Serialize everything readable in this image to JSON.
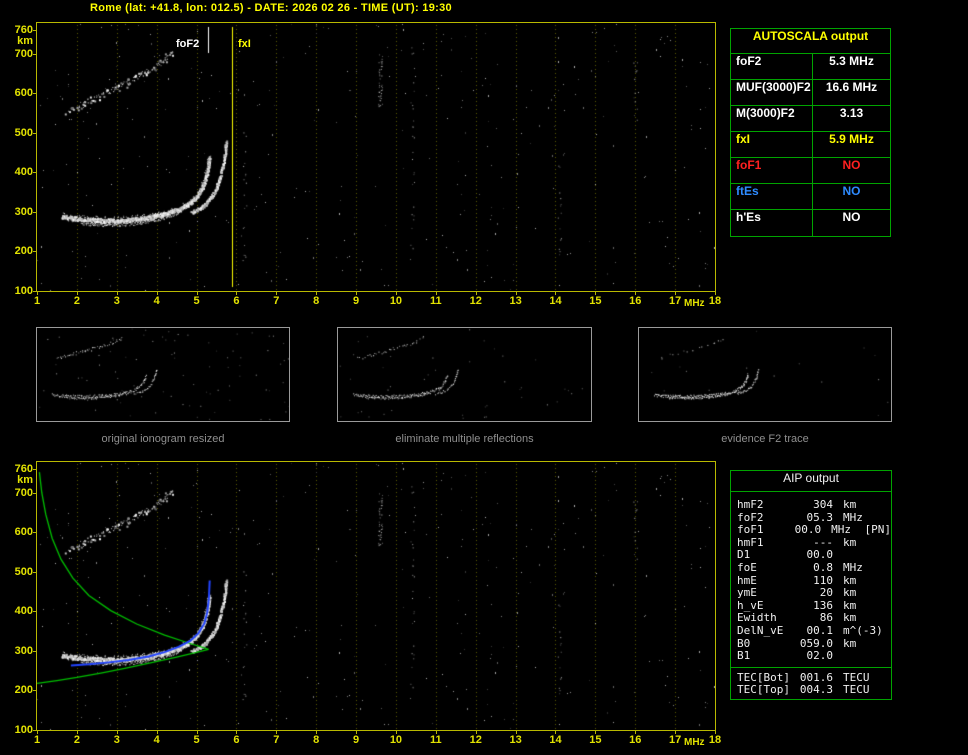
{
  "title": "Rome (lat: +41.8, lon: 012.5) - DATE: 2026 02 26 - TIME (UT): 19:30",
  "colors": {
    "background": "#000000",
    "axis_border": "#b9b900",
    "tick_text": "#e3e300",
    "grid": "#5f5f00",
    "table_border": "#00a400",
    "accent_yellow": "#ffff00",
    "accent_red": "#ff2020",
    "accent_blue": "#2e8bff",
    "trace_white": "#ffffff",
    "profile_green": "#00c000",
    "restored_blue": "#2244ff",
    "caption_gray": "#8f8f8f"
  },
  "autoscala_table": {
    "header": "AUTOSCALA output",
    "rows": [
      {
        "label": "foF2",
        "value": "5.3 MHz",
        "color": "#ffffff"
      },
      {
        "label": "MUF(3000)F2",
        "value": "16.6 MHz",
        "color": "#ffffff"
      },
      {
        "label": "M(3000)F2",
        "value": "3.13",
        "color": "#ffffff"
      },
      {
        "label": "fxI",
        "value": "5.9 MHz",
        "color": "#ffff00"
      },
      {
        "label": "foF1",
        "value": "NO",
        "color": "#ff2020"
      },
      {
        "label": "ftEs",
        "value": "NO",
        "color": "#2e8bff"
      },
      {
        "label": "h'Es",
        "value": "NO",
        "color": "#ffffff"
      }
    ]
  },
  "aip_table": {
    "header": "AIP output",
    "rows": [
      {
        "label": "hmF2",
        "value": "304",
        "unit": "km",
        "extra": ""
      },
      {
        "label": "foF2",
        "value": "05.3",
        "unit": "MHz",
        "extra": ""
      },
      {
        "label": "foF1",
        "value": "00.0",
        "unit": "MHz",
        "extra": "[PN]"
      },
      {
        "label": "hmF1",
        "value": "---",
        "unit": "km",
        "extra": ""
      },
      {
        "label": "D1",
        "value": "00.0",
        "unit": "",
        "extra": ""
      },
      {
        "label": "foE",
        "value": "0.8",
        "unit": "MHz",
        "extra": ""
      },
      {
        "label": "hmE",
        "value": "110",
        "unit": "km",
        "extra": ""
      },
      {
        "label": "ymE",
        "value": "20",
        "unit": "km",
        "extra": ""
      },
      {
        "label": "h_vE",
        "value": "136",
        "unit": "km",
        "extra": ""
      },
      {
        "label": "Ewidth",
        "value": "86",
        "unit": "km",
        "extra": ""
      },
      {
        "label": "DelN_vE",
        "value": "00.1",
        "unit": "m^(-3)",
        "extra": ""
      },
      {
        "label": "B0",
        "value": "059.0",
        "unit": "km",
        "extra": ""
      },
      {
        "label": "B1",
        "value": "02.0",
        "unit": "",
        "extra": ""
      }
    ],
    "tec_rows": [
      {
        "label": "TEC[Bot]",
        "value": "001.6",
        "unit": "TECU",
        "extra": ""
      },
      {
        "label": "TEC[Top]",
        "value": "004.3",
        "unit": "TECU",
        "extra": ""
      }
    ]
  },
  "thumbnails": [
    {
      "caption": "original ionogram resized"
    },
    {
      "caption": "eliminate multiple reflections"
    },
    {
      "caption": "evidence F2 trace"
    }
  ],
  "chart_data": [
    {
      "id": "main-ionogram",
      "type": "scatter",
      "title": "",
      "xlabel": "MHz",
      "ylabel": "km",
      "x_range": [
        1,
        18
      ],
      "y_range": [
        100,
        760
      ],
      "x_ticks": [
        1,
        2,
        3,
        4,
        5,
        6,
        7,
        8,
        9,
        10,
        11,
        12,
        13,
        14,
        15,
        16,
        17,
        18
      ],
      "y_ticks": [
        760,
        700,
        600,
        500,
        400,
        300,
        200,
        100
      ],
      "grid": "vertical-dotted",
      "markers": {
        "foF2_MHz": 5.3,
        "fxI_MHz": 5.9
      },
      "marker_labels": {
        "foF2": "foF2",
        "fxI": "fxI"
      },
      "thumbnail_x_range": [
        1,
        11
      ],
      "noise_seed": 1234,
      "noise_dots": 340,
      "streaks": [
        {
          "f": 9.6,
          "k0": 560,
          "k1": 700,
          "n": 45
        },
        {
          "f": 10.4,
          "k0": 140,
          "k1": 720,
          "n": 25
        },
        {
          "f": 6.2,
          "k0": 150,
          "k1": 520,
          "n": 18
        },
        {
          "f": 14.1,
          "k0": 160,
          "k1": 420,
          "n": 14
        },
        {
          "f": 16.0,
          "k0": 520,
          "k1": 700,
          "n": 12
        }
      ],
      "traces": {
        "f2_ordinary": [
          [
            1.6,
            290
          ],
          [
            1.9,
            285
          ],
          [
            2.3,
            281
          ],
          [
            2.8,
            279
          ],
          [
            3.3,
            281
          ],
          [
            3.8,
            287
          ],
          [
            4.2,
            296
          ],
          [
            4.55,
            308
          ],
          [
            4.8,
            322
          ],
          [
            5.0,
            340
          ],
          [
            5.13,
            362
          ],
          [
            5.22,
            388
          ],
          [
            5.28,
            414
          ],
          [
            5.31,
            438
          ]
        ],
        "f2_lower": [
          [
            2.1,
            271
          ],
          [
            2.6,
            268
          ],
          [
            3.1,
            268
          ],
          [
            3.6,
            272
          ],
          [
            4.0,
            280
          ],
          [
            4.35,
            291
          ],
          [
            4.6,
            303
          ]
        ],
        "f2_extraordinary": [
          [
            4.85,
            300
          ],
          [
            5.1,
            312
          ],
          [
            5.3,
            330
          ],
          [
            5.45,
            352
          ],
          [
            5.55,
            378
          ],
          [
            5.63,
            408
          ],
          [
            5.69,
            444
          ],
          [
            5.73,
            480
          ]
        ],
        "second_hop": [
          [
            1.75,
            555
          ],
          [
            2.1,
            572
          ],
          [
            2.5,
            592
          ],
          [
            2.9,
            610
          ],
          [
            3.3,
            630
          ],
          [
            3.65,
            650
          ],
          [
            3.95,
            668
          ],
          [
            4.2,
            686
          ],
          [
            4.4,
            706
          ]
        ]
      }
    },
    {
      "id": "profile-ionogram",
      "type": "scatter",
      "title": "",
      "xlabel": "MHz",
      "ylabel": "km",
      "x_range": [
        1,
        18
      ],
      "y_range": [
        100,
        760
      ],
      "x_ticks": [
        1,
        2,
        3,
        4,
        5,
        6,
        7,
        8,
        9,
        10,
        11,
        12,
        13,
        14,
        15,
        16,
        17,
        18
      ],
      "y_ticks": [
        760,
        700,
        600,
        500,
        400,
        300,
        200,
        100
      ],
      "grid": "vertical-dotted",
      "noise_seed": 1234,
      "noise_dots": 340,
      "streaks": [
        {
          "f": 9.6,
          "k0": 560,
          "k1": 700,
          "n": 45
        },
        {
          "f": 10.4,
          "k0": 140,
          "k1": 720,
          "n": 25
        },
        {
          "f": 6.2,
          "k0": 150,
          "k1": 520,
          "n": 18
        },
        {
          "f": 14.1,
          "k0": 160,
          "k1": 420,
          "n": 14
        },
        {
          "f": 16.0,
          "k0": 520,
          "k1": 700,
          "n": 12
        }
      ],
      "traces": {
        "f2_ordinary": [
          [
            1.6,
            290
          ],
          [
            1.9,
            285
          ],
          [
            2.3,
            281
          ],
          [
            2.8,
            279
          ],
          [
            3.3,
            281
          ],
          [
            3.8,
            287
          ],
          [
            4.2,
            296
          ],
          [
            4.55,
            308
          ],
          [
            4.8,
            322
          ],
          [
            5.0,
            340
          ],
          [
            5.13,
            362
          ],
          [
            5.22,
            388
          ],
          [
            5.28,
            414
          ],
          [
            5.31,
            438
          ]
        ],
        "f2_lower": [
          [
            2.1,
            271
          ],
          [
            2.6,
            268
          ],
          [
            3.1,
            268
          ],
          [
            3.6,
            272
          ],
          [
            4.0,
            280
          ],
          [
            4.35,
            291
          ],
          [
            4.6,
            303
          ]
        ],
        "f2_extraordinary": [
          [
            4.85,
            300
          ],
          [
            5.1,
            312
          ],
          [
            5.3,
            330
          ],
          [
            5.45,
            352
          ],
          [
            5.55,
            378
          ],
          [
            5.63,
            408
          ],
          [
            5.69,
            444
          ],
          [
            5.73,
            480
          ]
        ],
        "second_hop": [
          [
            1.75,
            555
          ],
          [
            2.1,
            572
          ],
          [
            2.5,
            592
          ],
          [
            2.9,
            610
          ],
          [
            3.3,
            630
          ],
          [
            3.65,
            650
          ],
          [
            3.95,
            668
          ],
          [
            4.2,
            686
          ],
          [
            4.4,
            706
          ]
        ]
      },
      "profile_green": {
        "topside": [
          [
            1.06,
            752
          ],
          [
            1.12,
            700
          ],
          [
            1.22,
            645
          ],
          [
            1.38,
            585
          ],
          [
            1.6,
            532
          ],
          [
            1.9,
            484
          ],
          [
            2.3,
            440
          ],
          [
            2.85,
            402
          ],
          [
            3.5,
            368
          ],
          [
            4.2,
            340
          ],
          [
            4.8,
            320
          ],
          [
            5.15,
            309
          ],
          [
            5.3,
            304
          ]
        ],
        "bottomside": [
          [
            5.3,
            304
          ],
          [
            5.0,
            296
          ],
          [
            4.5,
            284
          ],
          [
            3.9,
            271
          ],
          [
            3.2,
            256
          ],
          [
            2.6,
            244
          ],
          [
            2.0,
            233
          ],
          [
            1.5,
            225
          ],
          [
            1.0,
            218
          ]
        ]
      },
      "restored_trace_blue": [
        [
          1.85,
          263
        ],
        [
          2.3,
          266
        ],
        [
          2.8,
          271
        ],
        [
          3.3,
          277
        ],
        [
          3.8,
          286
        ],
        [
          4.2,
          297
        ],
        [
          4.55,
          310
        ],
        [
          4.85,
          326
        ],
        [
          5.05,
          345
        ],
        [
          5.2,
          370
        ],
        [
          5.27,
          398
        ],
        [
          5.31,
          432
        ],
        [
          5.33,
          478
        ]
      ]
    }
  ]
}
